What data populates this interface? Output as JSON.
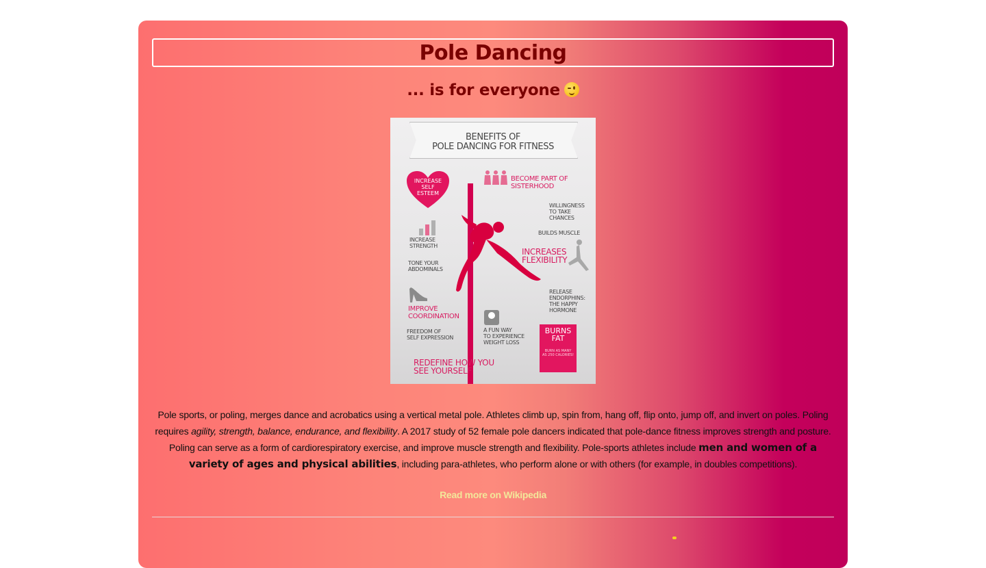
{
  "page": {
    "title": "Pole Dancing",
    "subtitle": "... is for everyone",
    "subtitle_emoji": "winking-face-icon"
  },
  "infographic": {
    "banner": "BENEFITS OF\nPOLE DANCING FOR FITNESS",
    "heart": "INCREASE\nSELF\nESTEEM",
    "labels": {
      "sisterhood": "BECOME PART OF\nSISTERHOOD",
      "willingness": "WILLINGNESS\nTO TAKE\nCHANCES",
      "builds_muscle": "BUILDS MUSCLE",
      "increase_strength": "INCREASE\nSTRENGTH",
      "flexibility": "INCREASES\nFLEXIBILITY",
      "abdominals": "TONE YOUR\nABDOMINALS",
      "endorphins": "RELEASE\nENDORPHINS:\nTHE HAPPY\nHORMONE",
      "coordination": "IMPROVE\nCOORDINATION",
      "weight_loss": "A FUN WAY\nTO EXPERIENCE\nWEIGHT LOSS",
      "self_expression": "FREEDOM OF\nSELF EXPRESSION",
      "burns_fat": "BURNS\nFAT",
      "burns_fat_small": "BURN AS MANY\nAS 250 CALORIES!",
      "redefine": "REDEFINE HOW YOU\nSEE YOURSELF"
    },
    "colors": {
      "accent": "#d81b60",
      "pole": "#d2004f"
    }
  },
  "description": {
    "p1": "Pole sports, or poling, merges dance and acrobatics using a vertical metal pole. Athletes climb up, spin from, hang off, flip onto, jump off, and invert on poles. Poling requires ",
    "italic": "agility, strength, balance, endurance, and flexibility",
    "p2": ". A 2017 study of 52 female pole dancers indicated that pole-dance fitness improves strength and posture. Poling can serve as a form of cardiorespiratory exercise, and improve muscle strength and flexibility. Pole-sports athletes include ",
    "bold": "men and women of a variety of ages and physical abilities",
    "p3": ", including para-athletes, who perform alone or with others (for example, in doubles competitions)."
  },
  "link": {
    "read_more": "Read more on Wikipedia"
  },
  "colors": {
    "title": "#7a0000",
    "link": "#f3e79a",
    "gradient_start": "#fd6f6f",
    "gradient_end": "#c0005a"
  }
}
